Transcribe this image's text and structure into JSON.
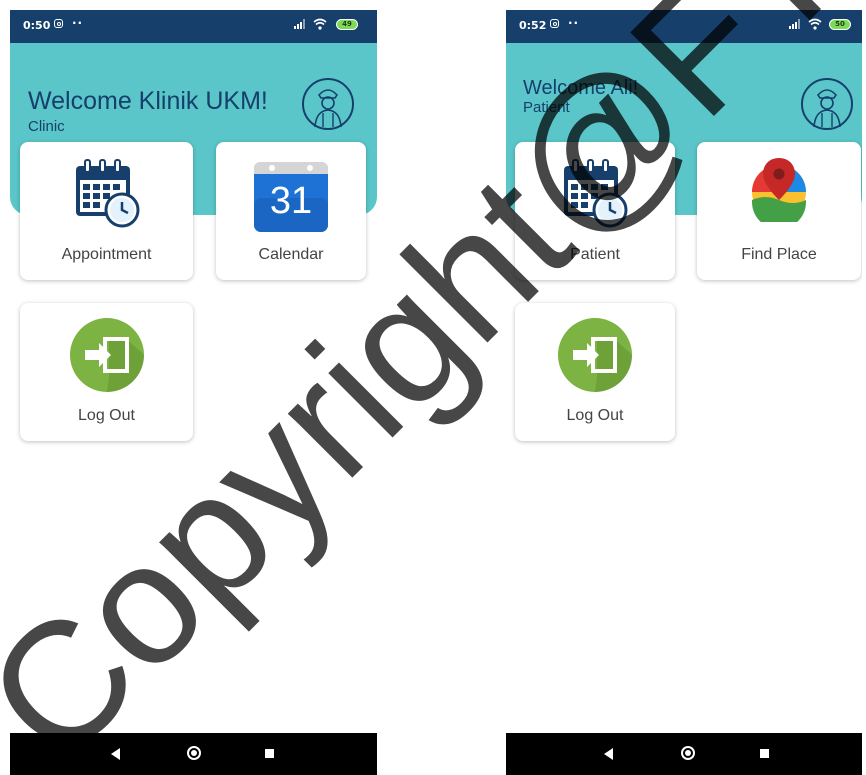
{
  "screens": [
    {
      "status": {
        "time": "0:50",
        "dots": "··",
        "battery": "49"
      },
      "header": {
        "welcome": "Welcome Klinik UKM!",
        "role": "Clinic"
      },
      "tiles": [
        "Appointment",
        "Calendar",
        "Log Out"
      ],
      "calendar_day": "31"
    },
    {
      "status": {
        "time": "0:52",
        "dots": "··",
        "battery": "50"
      },
      "header": {
        "welcome": "Welcome Ali!",
        "role": "Patient"
      },
      "tiles": [
        "Patient",
        "Find Place",
        "Log Out"
      ]
    }
  ],
  "colors": {
    "statusbar": "#16406b",
    "header": "#5ac6c9",
    "title_text": "#16406b",
    "logout_icon": "#7cb342",
    "calendar_blue": "#1e72d6"
  },
  "icons": [
    "instagram-icon",
    "signal-icon",
    "wifi-icon",
    "battery-icon",
    "doctor-icon",
    "calendar-clock-icon",
    "google-calendar-icon",
    "exit-door-icon",
    "map-pin-icon",
    "nav-back-icon",
    "nav-home-icon",
    "nav-recent-icon"
  ],
  "watermark": "Copyright@FTSM"
}
